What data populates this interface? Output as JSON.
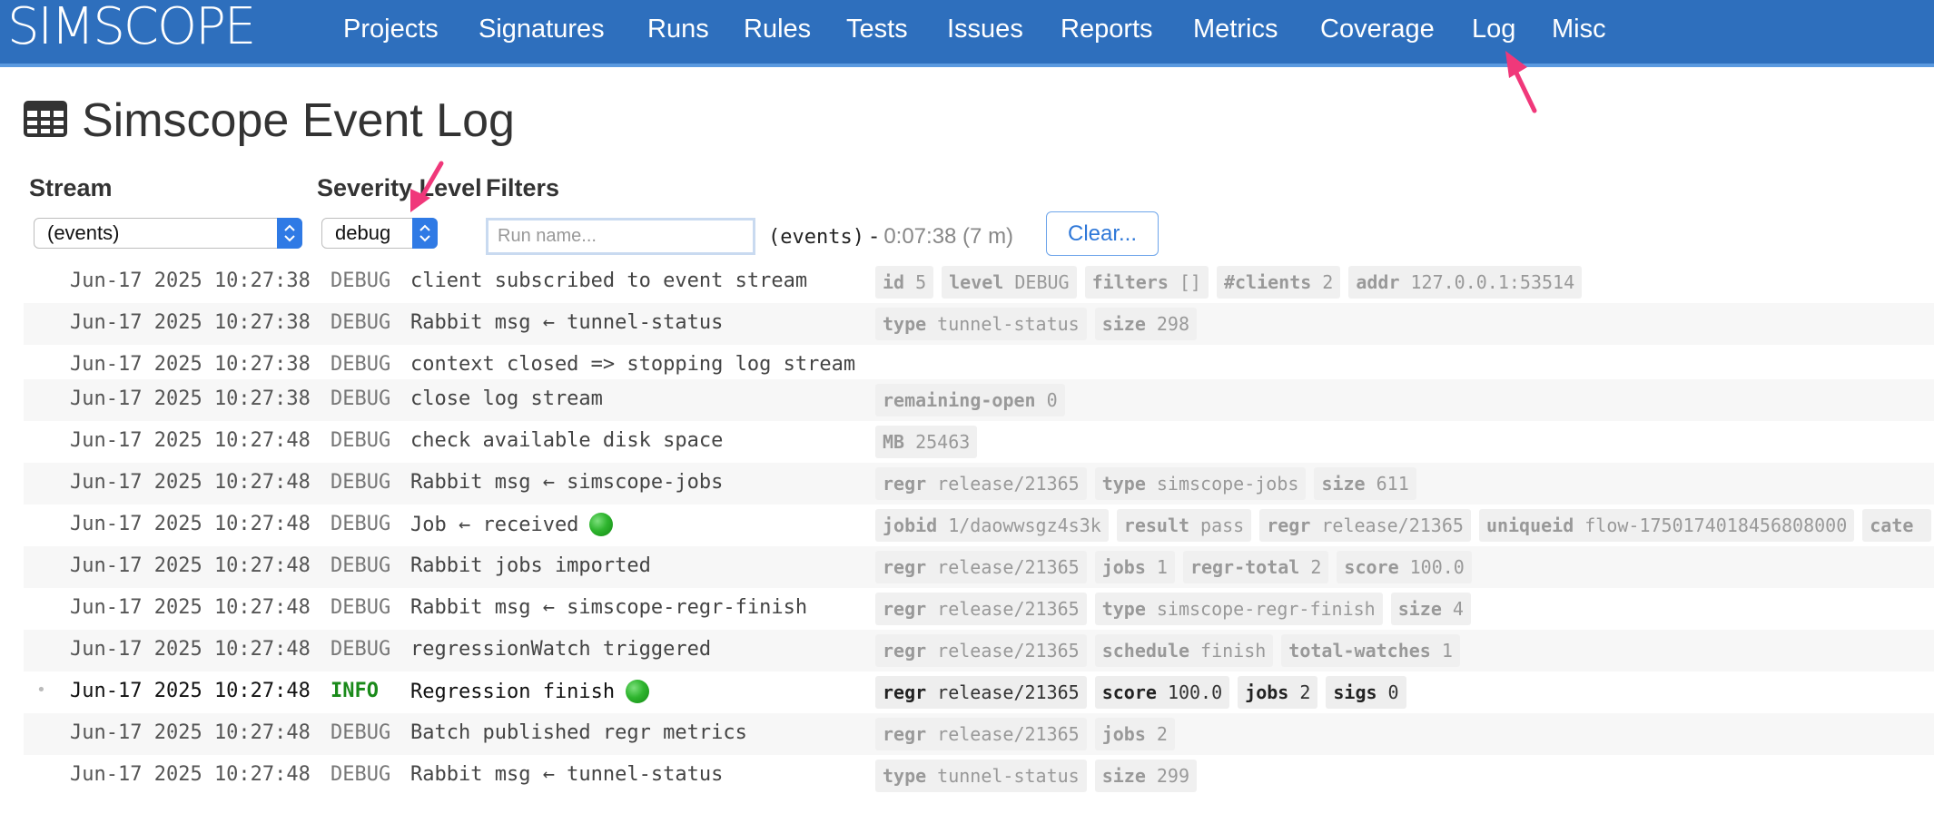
{
  "brand": "SIMSCOPE",
  "nav": [
    {
      "label": "Projects"
    },
    {
      "label": "Signatures"
    },
    {
      "label": "Runs"
    },
    {
      "label": "Rules"
    },
    {
      "label": "Tests"
    },
    {
      "label": "Issues"
    },
    {
      "label": "Reports"
    },
    {
      "label": "Metrics"
    },
    {
      "label": "Coverage"
    },
    {
      "label": "Log"
    },
    {
      "label": "Misc"
    }
  ],
  "page": {
    "title": "Simscope Event Log",
    "title_icon": "table-icon"
  },
  "form": {
    "stream_label": "Stream",
    "stream_value": "(events)",
    "severity_label": "Severity Level",
    "severity_value": "debug",
    "filters_label": "Filters",
    "run_placeholder": "Run name...",
    "status_stream": "(events)",
    "status_sep": "-",
    "status_duration": "0:07:38 (7 m)",
    "clear_label": "Clear..."
  },
  "colors": {
    "nav_bg": "#2e6fbd",
    "info": "#1a8a1a",
    "pass_dot": "#2fb52f",
    "annotation_arrow": "#f0387a"
  },
  "rows": [
    {
      "ts": "Jun-17 2025 10:27:38",
      "level": "DEBUG",
      "msg": "client subscribed to event stream",
      "dot": false,
      "tags": [
        {
          "k": "id",
          "v": "5"
        },
        {
          "k": "level",
          "v": "DEBUG"
        },
        {
          "k": "filters",
          "v": "[]"
        },
        {
          "k": "#clients",
          "v": "2"
        },
        {
          "k": "addr",
          "v": "127.0.0.1:53514"
        }
      ]
    },
    {
      "ts": "Jun-17 2025 10:27:38",
      "level": "DEBUG",
      "msg": "Rabbit msg ← tunnel-status",
      "dot": false,
      "tags": [
        {
          "k": "type",
          "v": "tunnel-status"
        },
        {
          "k": "size",
          "v": "298"
        }
      ]
    },
    {
      "ts": "Jun-17 2025 10:27:38",
      "level": "DEBUG",
      "msg": "context closed => stopping log stream",
      "dot": false,
      "tags": []
    },
    {
      "ts": "Jun-17 2025 10:27:38",
      "level": "DEBUG",
      "msg": "close log stream",
      "dot": false,
      "tags": [
        {
          "k": "remaining-open",
          "v": "0"
        }
      ]
    },
    {
      "ts": "Jun-17 2025 10:27:48",
      "level": "DEBUG",
      "msg": "check available disk space",
      "dot": false,
      "tags": [
        {
          "k": "MB",
          "v": "25463"
        }
      ]
    },
    {
      "ts": "Jun-17 2025 10:27:48",
      "level": "DEBUG",
      "msg": "Rabbit msg ← simscope-jobs",
      "dot": false,
      "tags": [
        {
          "k": "regr",
          "v": "release/21365"
        },
        {
          "k": "type",
          "v": "simscope-jobs"
        },
        {
          "k": "size",
          "v": "611"
        }
      ]
    },
    {
      "ts": "Jun-17 2025 10:27:48",
      "level": "DEBUG",
      "msg": "Job ← received",
      "dot": true,
      "tags": [
        {
          "k": "jobid",
          "v": "1/daowwsgz4s3k"
        },
        {
          "k": "result",
          "v": "pass"
        },
        {
          "k": "regr",
          "v": "release/21365"
        },
        {
          "k": "uniqueid",
          "v": "flow-1750174018456808000"
        },
        {
          "k": "cate",
          "v": ""
        }
      ]
    },
    {
      "ts": "Jun-17 2025 10:27:48",
      "level": "DEBUG",
      "msg": "Rabbit jobs imported",
      "dot": false,
      "tags": [
        {
          "k": "regr",
          "v": "release/21365"
        },
        {
          "k": "jobs",
          "v": "1"
        },
        {
          "k": "regr-total",
          "v": "2"
        },
        {
          "k": "score",
          "v": "100.0"
        }
      ]
    },
    {
      "ts": "Jun-17 2025 10:27:48",
      "level": "DEBUG",
      "msg": "Rabbit msg ← simscope-regr-finish",
      "dot": false,
      "tags": [
        {
          "k": "regr",
          "v": "release/21365"
        },
        {
          "k": "type",
          "v": "simscope-regr-finish"
        },
        {
          "k": "size",
          "v": "4"
        }
      ]
    },
    {
      "ts": "Jun-17 2025 10:27:48",
      "level": "DEBUG",
      "msg": "regressionWatch triggered",
      "dot": false,
      "tags": [
        {
          "k": "regr",
          "v": "release/21365"
        },
        {
          "k": "schedule",
          "v": "finish"
        },
        {
          "k": "total-watches",
          "v": "1"
        }
      ]
    },
    {
      "ts": "Jun-17 2025 10:27:48",
      "level": "INFO",
      "msg": "Regression finish",
      "dot": true,
      "bullet": "•",
      "tags": [
        {
          "k": "regr",
          "v": "release/21365"
        },
        {
          "k": "score",
          "v": "100.0"
        },
        {
          "k": "jobs",
          "v": "2"
        },
        {
          "k": "sigs",
          "v": "0"
        }
      ]
    },
    {
      "ts": "Jun-17 2025 10:27:48",
      "level": "DEBUG",
      "msg": "Batch published regr metrics",
      "dot": false,
      "tags": [
        {
          "k": "regr",
          "v": "release/21365"
        },
        {
          "k": "jobs",
          "v": "2"
        }
      ]
    },
    {
      "ts": "Jun-17 2025 10:27:48",
      "level": "DEBUG",
      "msg": "Rabbit msg ← tunnel-status",
      "dot": false,
      "tags": [
        {
          "k": "type",
          "v": "tunnel-status"
        },
        {
          "k": "size",
          "v": "299"
        }
      ]
    }
  ]
}
